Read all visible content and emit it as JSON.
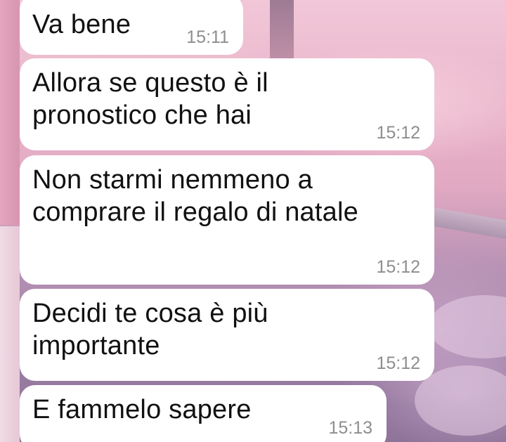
{
  "chat": {
    "messages": [
      {
        "text": "Va bene",
        "time": "15:11"
      },
      {
        "text": "Allora se questo è il\npronostico che hai",
        "time": "15:12"
      },
      {
        "text": "Non starmi nemmeno a\ncomprare il regalo di natale",
        "time": "15:12"
      },
      {
        "text": "Decidi te cosa è più\nimportante",
        "time": "15:12"
      },
      {
        "text": "E fammelo sapere",
        "time": "15:13"
      }
    ]
  },
  "theme": {
    "bubble_color": "#ffffff",
    "text_color": "#111111",
    "time_color": "#8e8e8e",
    "background_top": "#f1c7d8",
    "background_bottom": "#8f7499"
  }
}
